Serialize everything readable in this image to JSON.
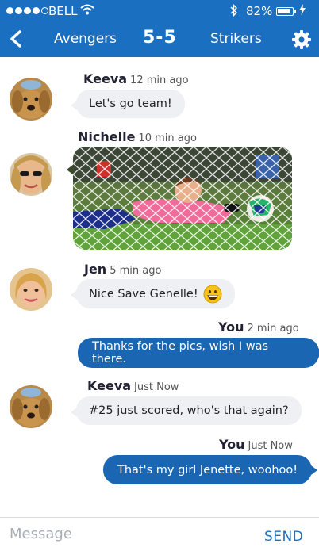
{
  "status_bar": {
    "carrier": "BELL",
    "battery_percent": "82%",
    "battery_level": 0.82
  },
  "header": {
    "team_home": "Avengers",
    "score": "5-5",
    "team_away": "Strikers"
  },
  "messages": [
    {
      "sender": "Keeva",
      "time": "12 min ago",
      "text": "Let's go team!",
      "direction": "incoming",
      "avatar": "dog-avatar"
    },
    {
      "sender": "Nichelle",
      "time": "10 min ago",
      "type": "photo",
      "direction": "incoming",
      "avatar": "woman-sunglasses-avatar"
    },
    {
      "sender": "Jen",
      "time": "5 min ago",
      "text": "Nice Save Genelle!",
      "direction": "incoming",
      "avatar": "woman-blonde-avatar",
      "emoji": "grinning-face"
    },
    {
      "sender": "You",
      "time": "2 min ago",
      "text": "Thanks for the pics, wish I was there.",
      "direction": "outgoing"
    },
    {
      "sender": "Keeva",
      "time": "Just Now",
      "text": "#25 just scored, who's that again?",
      "direction": "incoming",
      "avatar": "dog-avatar"
    },
    {
      "sender": "You",
      "time": "Just Now",
      "text": "That's my girl Jenette, woohoo!",
      "direction": "outgoing"
    }
  ],
  "composer": {
    "placeholder": "Message",
    "send_label": "SEND"
  },
  "colors": {
    "primary": "#1b6fc0",
    "outgoing_bubble": "#1b66b2",
    "incoming_bubble": "#eef0f3"
  }
}
